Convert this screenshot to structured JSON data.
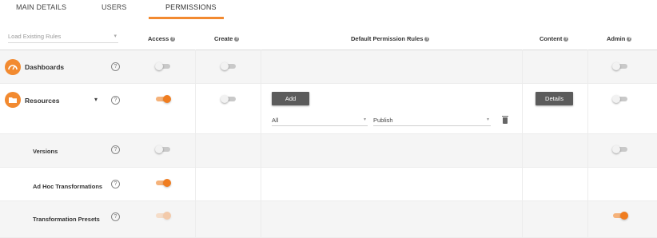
{
  "tabs": [
    {
      "label": "MAIN DETAILS"
    },
    {
      "label": "USERS"
    },
    {
      "label": "PERMISSIONS"
    }
  ],
  "header": {
    "load_placeholder": "Load Existing Rules",
    "access": "Access",
    "create": "Create",
    "default_rules": "Default Permission Rules",
    "content": "Content",
    "admin": "Admin"
  },
  "rows": {
    "dashboards": {
      "label": "Dashboards",
      "access": false,
      "create": false,
      "admin": false
    },
    "resources": {
      "label": "Resources",
      "access": true,
      "create": false,
      "admin": false,
      "add_label": "Add",
      "details_label": "Details",
      "rule_scope": "All",
      "rule_action": "Publish"
    },
    "versions": {
      "label": "Versions",
      "access": false,
      "admin": false
    },
    "adhoc": {
      "label": "Ad Hoc Transformations",
      "access": true
    },
    "presets": {
      "label": "Transformation Presets",
      "access": true,
      "admin": true
    }
  },
  "colors": {
    "accent": "#f28a30",
    "button": "#5b5b5b"
  },
  "icons": {
    "help": "?",
    "dropdown": "▾"
  }
}
